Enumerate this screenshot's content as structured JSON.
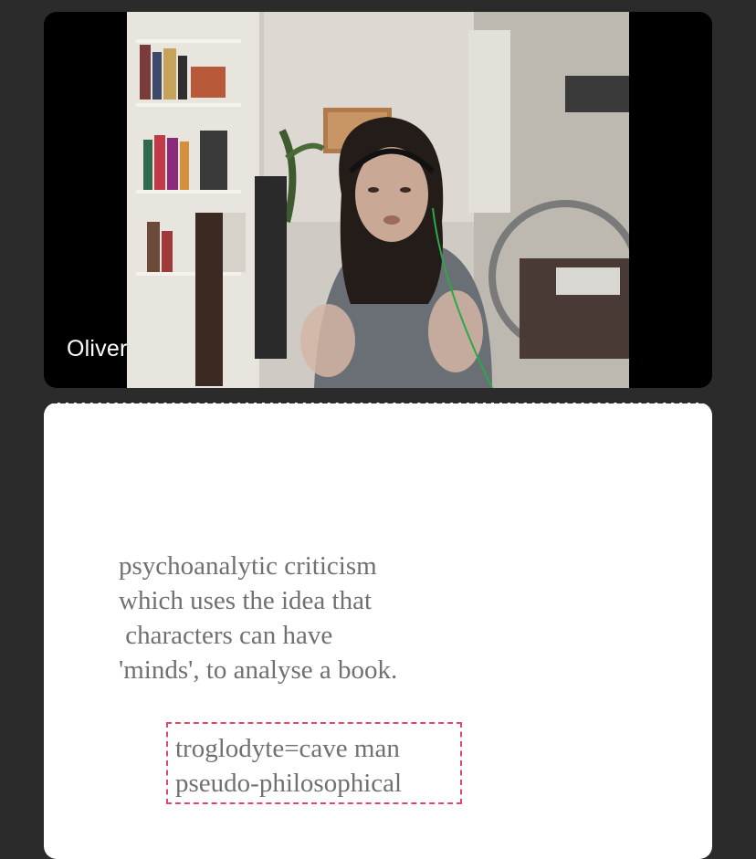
{
  "participant": {
    "name": "Oliver"
  },
  "whiteboard": {
    "note_lines": [
      "psychoanalytic criticism",
      "which uses the idea that",
      " characters can have",
      "'minds', to analyse a book."
    ],
    "selected_lines": [
      "troglodyte=cave man",
      "pseudo-philosophical"
    ],
    "selection_color": "#e0476b",
    "text_color": "#707070"
  }
}
